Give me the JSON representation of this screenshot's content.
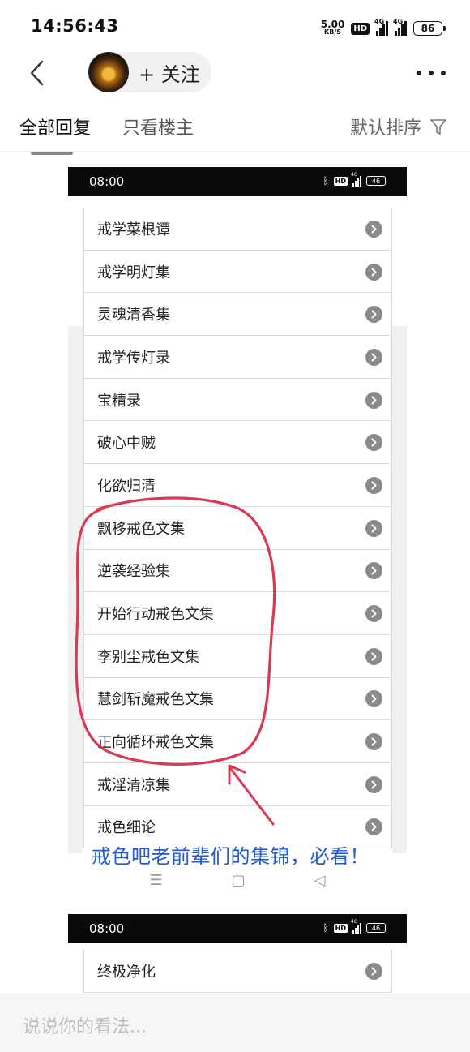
{
  "status_bar": {
    "time": "14:56:43",
    "net_speed_value": "5.00",
    "net_speed_unit": "KB/S",
    "hd_label": "HD",
    "signal_label": "4G",
    "battery": "86"
  },
  "nav": {
    "follow_label": "+ 关注",
    "icons": [
      "back-icon",
      "more-icon"
    ]
  },
  "tabs": {
    "all_replies": "全部回复",
    "op_only": "只看楼主",
    "sort_label": "默认排序"
  },
  "screenshot1": {
    "time": "08:00",
    "hd_label": "HD",
    "signal_label": "4G",
    "battery": "46",
    "items": [
      "戒学菜根谭",
      "戒学明灯集",
      "灵魂清香集",
      "戒学传灯录",
      "宝精录",
      "破心中贼",
      "化欲归清",
      "飘移戒色文集",
      "逆袭经验集",
      "开始行动戒色文集",
      "李别尘戒色文集",
      "慧剑斩魔戒色文集",
      "正向循环戒色文集",
      "戒淫清凉集",
      "戒色细论"
    ],
    "caption": "戒色吧老前辈们的集锦，必看！",
    "sys_nav": {
      "menu": "☰",
      "home": "▢",
      "back": "◁"
    }
  },
  "screenshot2": {
    "time": "08:00",
    "hd_label": "HD",
    "signal_label": "4G",
    "battery": "46",
    "items": [
      "终极净化"
    ]
  },
  "comment": {
    "placeholder": "说说你的看法..."
  },
  "colors": {
    "annotation_red": "#d83a52",
    "caption_blue": "#1f5ad0",
    "arrow_gray": "#8a8a8a"
  }
}
